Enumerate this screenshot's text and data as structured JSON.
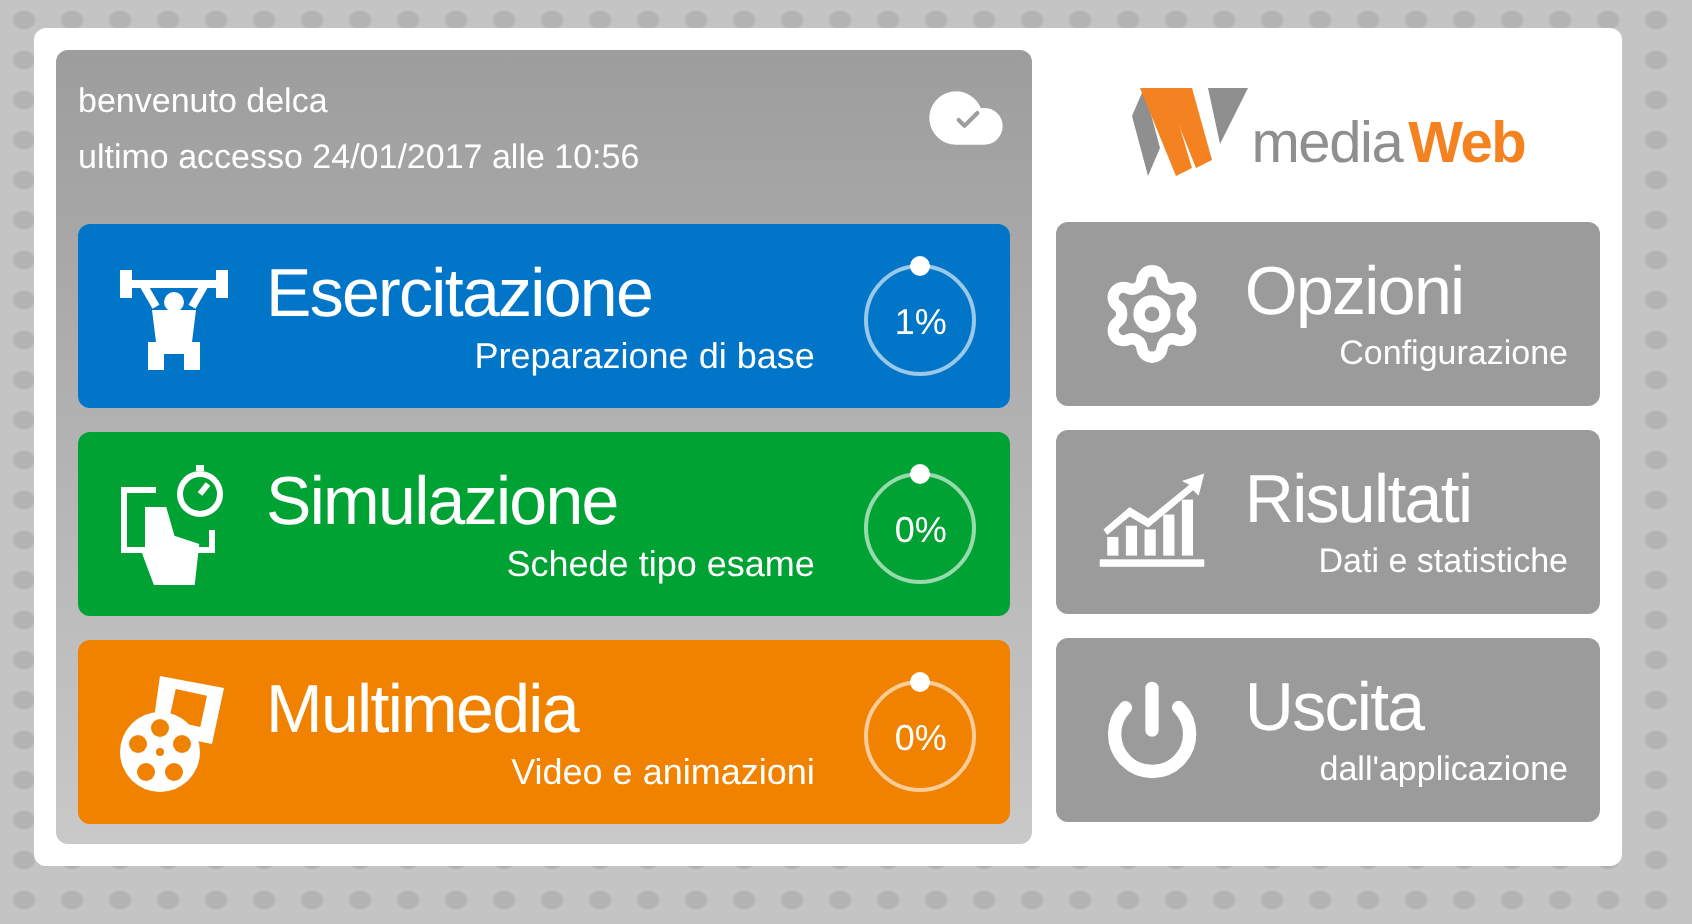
{
  "header": {
    "greeting": "benvenuto delca",
    "last_access": "ultimo accesso 24/01/2017 alle 10:56"
  },
  "logo": {
    "part_1": "media",
    "part_2": "Web"
  },
  "tiles": [
    {
      "kind": "exercise",
      "title": "Esercitazione",
      "subtitle": "Preparazione di base",
      "percent": "1%",
      "color": "#0175c7"
    },
    {
      "kind": "simulation",
      "title": "Simulazione",
      "subtitle": "Schede tipo esame",
      "percent": "0%",
      "color": "#00a234"
    },
    {
      "kind": "multimedia",
      "title": "Multimedia",
      "subtitle": "Video e animazioni",
      "percent": "0%",
      "color": "#f18200"
    }
  ],
  "menu": [
    {
      "kind": "options",
      "title": "Opzioni",
      "subtitle": "Configurazione"
    },
    {
      "kind": "results",
      "title": "Risultati",
      "subtitle": "Dati e statistiche"
    },
    {
      "kind": "exit",
      "title": "Uscita",
      "subtitle": "dall'applicazione"
    }
  ]
}
